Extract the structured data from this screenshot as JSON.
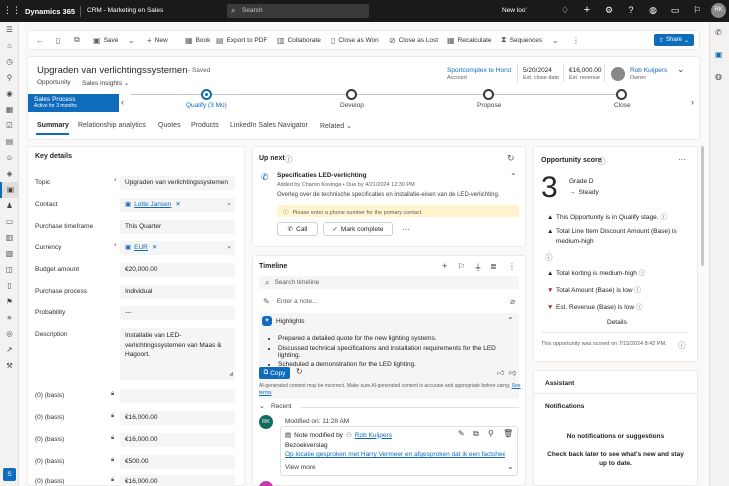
{
  "topbar": {
    "brand": "Dynamics 365",
    "app_name": "CRM - Marketing en Sales",
    "search_placeholder": "Search",
    "new_look_label": "New look",
    "avatar_initials": "RK"
  },
  "commands": {
    "save": "Save",
    "new": "New",
    "book": "Book",
    "export_pdf": "Export to PDF",
    "collaborate": "Collaborate",
    "close_won": "Close as Won",
    "close_lost": "Close as Lost",
    "recalculate": "Recalculate",
    "sequences": "Sequences",
    "share": "Share"
  },
  "header": {
    "title": "Upgraden van verlichtingssystemen",
    "saved_status": "- Saved",
    "entity": "Opportunity",
    "form": "Sales insights",
    "account_value": "Sportcomplex te Horst",
    "account_label": "Account",
    "close_date_value": "5/20/2024",
    "close_date_label": "Est. close date",
    "revenue_value": "€16,000.00",
    "revenue_label": "Est. revenue",
    "owner_value": "Rob Kuijpers",
    "owner_label": "Owner"
  },
  "bpf": {
    "process_name": "Sales Process",
    "process_sub": "Active for 3 months",
    "stages": [
      {
        "label": "Qualify (3 Mo)"
      },
      {
        "label": "Develop"
      },
      {
        "label": "Propose"
      },
      {
        "label": "Close"
      }
    ]
  },
  "tabs": [
    "Summary",
    "Relationship analytics",
    "Quotes",
    "Products",
    "LinkedIn Sales Navigator",
    "Related"
  ],
  "key_details": {
    "heading": "Key details",
    "fields": [
      {
        "label": "Topic",
        "value": "Upgraden van verlichtingssystemen"
      },
      {
        "label": "Contact",
        "value": "Lotte Jansen"
      },
      {
        "label": "Purchase timeframe",
        "value": "This Quarter"
      },
      {
        "label": "Currency",
        "value": "EUR"
      },
      {
        "label": "Budget amount",
        "value": "€20,000.00"
      },
      {
        "label": "Purchase process",
        "value": "Individual"
      },
      {
        "label": "Probability",
        "value": "---"
      },
      {
        "label": "Description",
        "value": "Installatie van LED-verlichtingssystemen van Maas & Hagoort."
      },
      {
        "label": "(0) (basis)",
        "value": ""
      },
      {
        "label": "(0) (basis)",
        "value": "€16,000.00"
      },
      {
        "label": "(0) (basis)",
        "value": "€16,000.00"
      },
      {
        "label": "(0) (basis)",
        "value": "€500.00"
      },
      {
        "label": "(0) (basis)",
        "value": "€16,000.00"
      }
    ]
  },
  "up_next": {
    "heading": "Up next",
    "task_title": "Specificaties LED-verlichting",
    "task_meta": "Added by Charon Kovinga • Due by 4/21/2024 12:30 PM",
    "task_desc": "Overleg over de technische specificaties en installatie-eisen van de LED-verlichting.",
    "warning": "Please enter a phone number for the primary contact.",
    "call_label": "Call",
    "mark_complete_label": "Mark complete"
  },
  "timeline": {
    "heading": "Timeline",
    "search_placeholder": "Search timeline",
    "note_placeholder": "Enter a note...",
    "highlights_title": "Highlights",
    "highlights": [
      "Prepared a detailed quote for the new lighting systems.",
      "Discussed technical specifications and installation requirements for the LED lighting.",
      "Scheduled a demonstration for the LED lighting."
    ],
    "copy_label": "Copy",
    "disclaimer": "AI-generated content may be incorrect. Make sure AI-generated content is accurate and appropriate before using.",
    "see_terms": "See terms",
    "recent_label": "Recent",
    "entry_initials": "RK",
    "entry_modified": "Modified on: 11:28 AM",
    "entry_note_prefix": "Note modified by",
    "entry_author": "Rob Kuijpers",
    "entry_title": "Bezoekverslag",
    "entry_link": "Op locatie gesproken met Harry Vermeer en afgesproken dat ik een factshee...",
    "view_more": "View more"
  },
  "opportunity_score": {
    "heading": "Opportunity score",
    "score": "3",
    "grade": "Grade D",
    "trend": "Steady",
    "factors": [
      {
        "text": "This Opportunity is in Qualify stage.",
        "direction": "up"
      },
      {
        "text": "Total Line Item Discount Amount (Base) is medium-high",
        "direction": "up"
      },
      {
        "text": "Total korting is medium-high",
        "direction": "up"
      },
      {
        "text": "Total Amount (Base) is low",
        "direction": "down"
      },
      {
        "text": "Est. Revenue (Base) is low",
        "direction": "down"
      }
    ],
    "details_label": "Details",
    "scored_text": "This opportunity was scored on 7/15/2024 8:42 PM."
  },
  "assistant": {
    "heading": "Assistant",
    "notifications_heading": "Notifications",
    "empty_title": "No notifications or suggestions",
    "empty_body": "Check back later to see what's new and stay up to date."
  },
  "colors": {
    "accent": "#0f6cbd",
    "topbar": "#1b1a19",
    "up_arrow": "#242424",
    "down_arrow": "#a4262c",
    "warning_bg": "#fff4ce"
  }
}
